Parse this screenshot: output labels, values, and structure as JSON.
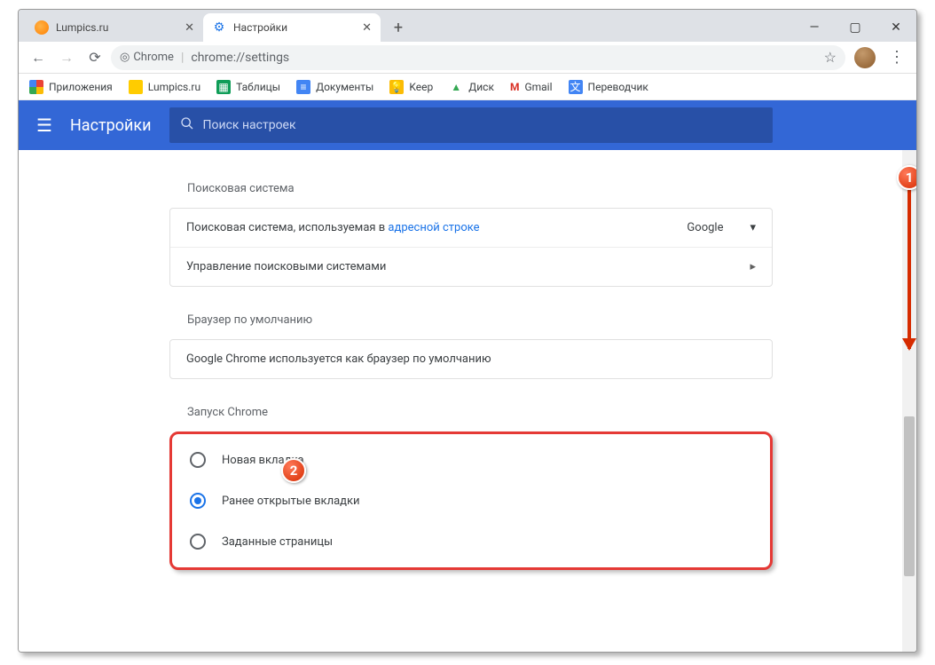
{
  "window": {
    "tabs": [
      {
        "title": "Lumpics.ru",
        "active": false
      },
      {
        "title": "Настройки",
        "active": true
      }
    ],
    "url_label": "Chrome",
    "url_path": "chrome://settings"
  },
  "bookmarks": {
    "apps": "Приложения",
    "items": [
      "Lumpics.ru",
      "Таблицы",
      "Документы",
      "Keep",
      "Диск",
      "Gmail",
      "Переводчик"
    ]
  },
  "header": {
    "title": "Настройки",
    "search_placeholder": "Поиск настроек"
  },
  "sections": {
    "search_engine": {
      "title": "Поисковая система",
      "row1_prefix": "Поисковая система, используемая в ",
      "row1_link": "адресной строке",
      "row1_select": "Google",
      "row2": "Управление поисковыми системами"
    },
    "default_browser": {
      "title": "Браузер по умолчанию",
      "row": "Google Chrome используется как браузер по умолчанию"
    },
    "startup": {
      "title": "Запуск Chrome",
      "options": [
        {
          "label": "Новая вкладка",
          "selected": false
        },
        {
          "label": "Ранее открытые вкладки",
          "selected": true
        },
        {
          "label": "Заданные страницы",
          "selected": false
        }
      ]
    }
  },
  "annotations": {
    "b1": "1",
    "b2": "2"
  }
}
